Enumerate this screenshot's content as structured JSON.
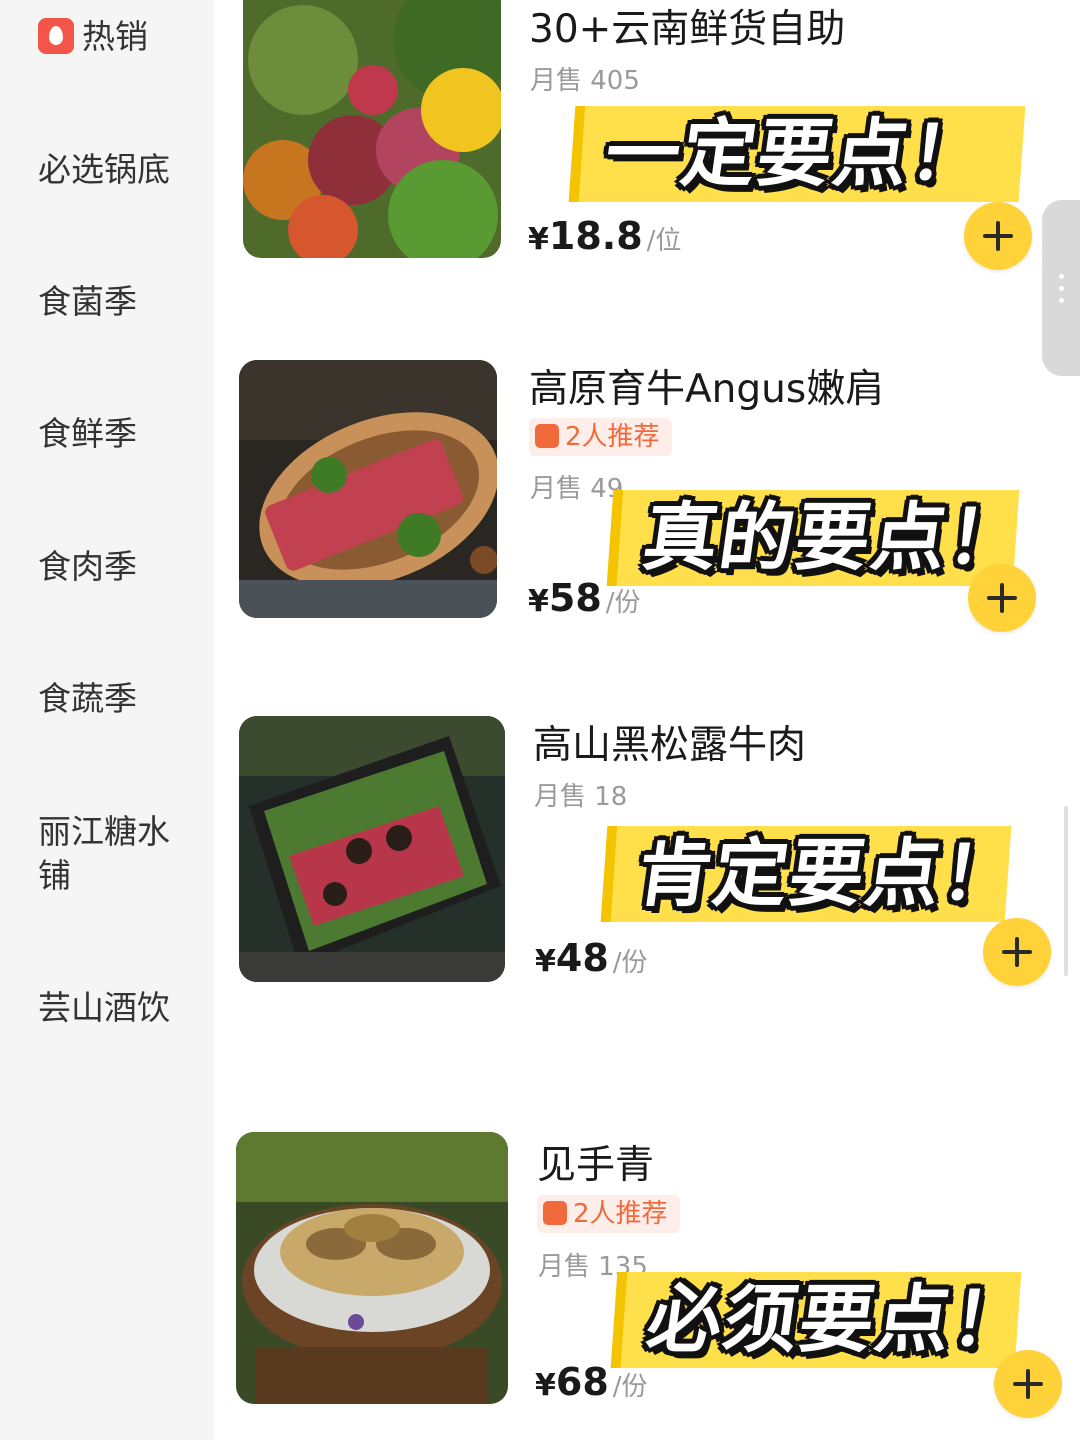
{
  "sidebar": {
    "items": [
      {
        "label": "热销",
        "icon": "fire-icon"
      },
      {
        "label": "必选锅底"
      },
      {
        "label": "食菌季"
      },
      {
        "label": "食鲜季"
      },
      {
        "label": "食肉季"
      },
      {
        "label": "食蔬季"
      },
      {
        "label": "丽江糖水铺"
      },
      {
        "label": "芸山酒饮"
      }
    ]
  },
  "products": [
    {
      "name": "30+云南鲜货自助",
      "badge": "",
      "sales": "月售 405",
      "currency": "¥",
      "price": "18.8",
      "unit": "/位",
      "promo": "一定要点！"
    },
    {
      "name": "高原育牛Angus嫩肩",
      "badge": "2人推荐",
      "sales": "月售 49",
      "currency": "¥",
      "price": "58",
      "unit": "/份",
      "promo": "真的要点！"
    },
    {
      "name": "高山黑松露牛肉",
      "badge": "",
      "sales": "月售 18",
      "currency": "¥",
      "price": "48",
      "unit": "/份",
      "promo": "肯定要点！"
    },
    {
      "name": "见手青",
      "badge": "2人推荐",
      "sales": "月售 135",
      "currency": "¥",
      "price": "68",
      "unit": "/份",
      "promo": "必须要点！"
    }
  ],
  "colors": {
    "accent": "#ffd23a",
    "promo": "#ffe04a",
    "badge": "#f06a3c"
  }
}
